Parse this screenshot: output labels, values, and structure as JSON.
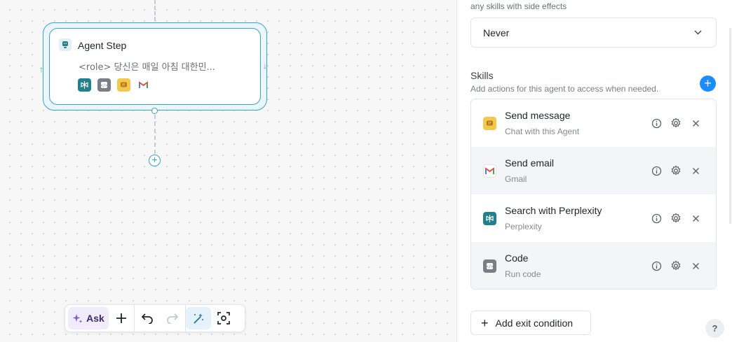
{
  "canvas": {
    "node": {
      "title": "Agent Step",
      "description": "<role> 당신은 매일 아침 대한민...",
      "skill_icons": [
        "perplexity-icon",
        "code-icon",
        "chat-icon",
        "gmail-icon"
      ]
    },
    "toolbar": {
      "ask_label": "Ask",
      "buttons": [
        "sparkle-icon",
        "plus-icon",
        "undo-icon",
        "redo-icon",
        "magic-wand-icon",
        "fit-view-icon"
      ]
    }
  },
  "panel": {
    "side_effects_label": "any skills with side effects",
    "approval_select": {
      "value": "Never"
    },
    "skills": {
      "title": "Skills",
      "subtitle": "Add actions for this agent to access when needed.",
      "items": [
        {
          "name": "Send message",
          "desc": "Chat with this Agent",
          "icon": "chat-icon"
        },
        {
          "name": "Send email",
          "desc": "Gmail",
          "icon": "gmail-icon"
        },
        {
          "name": "Search with Perplexity",
          "desc": "Perplexity",
          "icon": "perplexity-icon"
        },
        {
          "name": "Code",
          "desc": "Run code",
          "icon": "code-icon"
        }
      ]
    },
    "exit_condition_label": "Add exit condition",
    "help_label": "?"
  },
  "colors": {
    "accent": "#3aa0d8",
    "primary_button": "#1a8cff",
    "perplexity": "#20808d",
    "code": "#7a7f87",
    "chat": "#f2c94c"
  }
}
